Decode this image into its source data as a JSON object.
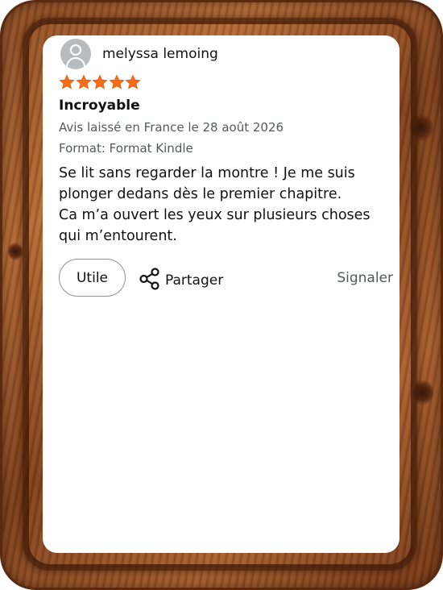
{
  "review": {
    "author": "melyssa lemoing",
    "rating": 5,
    "rating_max": 5,
    "title": "Incroyable",
    "location_date": "Avis laissé en France le 28 août 2026",
    "format": "Format: Format Kindle",
    "body_lines": [
      "Se lit sans regarder la montre ! Je me suis",
      "plonger dedans dès le premier chapitre.",
      "Ca m’a ouvert les yeux sur plusieurs choses",
      "qui m’entourent."
    ]
  },
  "actions": {
    "helpful_label": "Utile",
    "share_label": "Partager",
    "report_label": "Signaler"
  },
  "icons": {
    "avatar": "user-avatar-icon",
    "star": "star-icon",
    "share": "share-icon"
  },
  "colors": {
    "star": "#F96B15",
    "secondary_text": "#565959",
    "button_border": "#8D9096"
  }
}
